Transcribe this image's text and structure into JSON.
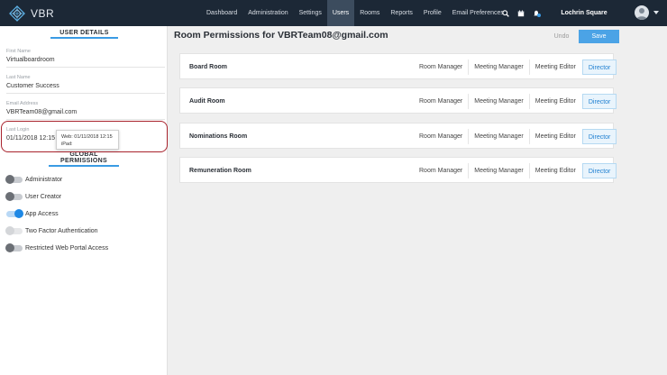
{
  "app": {
    "name": "VBR"
  },
  "nav": {
    "items": [
      {
        "label": "Dashboard"
      },
      {
        "label": "Administration"
      },
      {
        "label": "Settings"
      },
      {
        "label": "Users",
        "active": true
      },
      {
        "label": "Rooms"
      },
      {
        "label": "Reports"
      },
      {
        "label": "Profile"
      },
      {
        "label": "Email Preferences"
      }
    ],
    "icons": [
      "search-icon",
      "calendar-icon",
      "bell-icon"
    ],
    "org_name": "Lochrin Square"
  },
  "user_details": {
    "title": "USER DETAILS",
    "first_name": {
      "label": "First Name",
      "value": "Virtualboardroom"
    },
    "last_name": {
      "label": "Last Name",
      "value": "Customer Success"
    },
    "email": {
      "label": "Email Address",
      "value": "VBRTeam08@gmail.com"
    },
    "last_login": {
      "label": "Last Login",
      "value": "01/11/2018 12:15"
    },
    "tooltip": {
      "line1": "Web: 01/11/2018 12:15",
      "line2": "iPad:"
    }
  },
  "global_permissions": {
    "title": "GLOBAL PERMISSIONS",
    "items": [
      {
        "label": "Administrator",
        "state": "off"
      },
      {
        "label": "User Creator",
        "state": "off"
      },
      {
        "label": "App Access",
        "state": "on"
      },
      {
        "label": "Two Factor Authentication",
        "state": "disabled"
      },
      {
        "label": "Restricted Web Portal Access",
        "state": "off"
      }
    ]
  },
  "main": {
    "title": "Room Permissions for VBRTeam08@gmail.com",
    "undo_label": "Undo",
    "save_label": "Save",
    "rooms": [
      {
        "name": "Board Room",
        "roles": [
          "Room Manager",
          "Meeting Manager",
          "Meeting Editor",
          "Director"
        ],
        "selected": "Director"
      },
      {
        "name": "Audit Room",
        "roles": [
          "Room Manager",
          "Meeting Manager",
          "Meeting Editor",
          "Director"
        ],
        "selected": "Director"
      },
      {
        "name": "Nominations Room",
        "roles": [
          "Room Manager",
          "Meeting Manager",
          "Meeting Editor",
          "Director"
        ],
        "selected": "Director"
      },
      {
        "name": "Remuneration Room",
        "roles": [
          "Room Manager",
          "Meeting Manager",
          "Meeting Editor",
          "Director"
        ],
        "selected": "Director"
      }
    ]
  },
  "colors": {
    "nav_bg": "#1c2836",
    "accent": "#3a9be4",
    "highlight": "#a8222c"
  }
}
